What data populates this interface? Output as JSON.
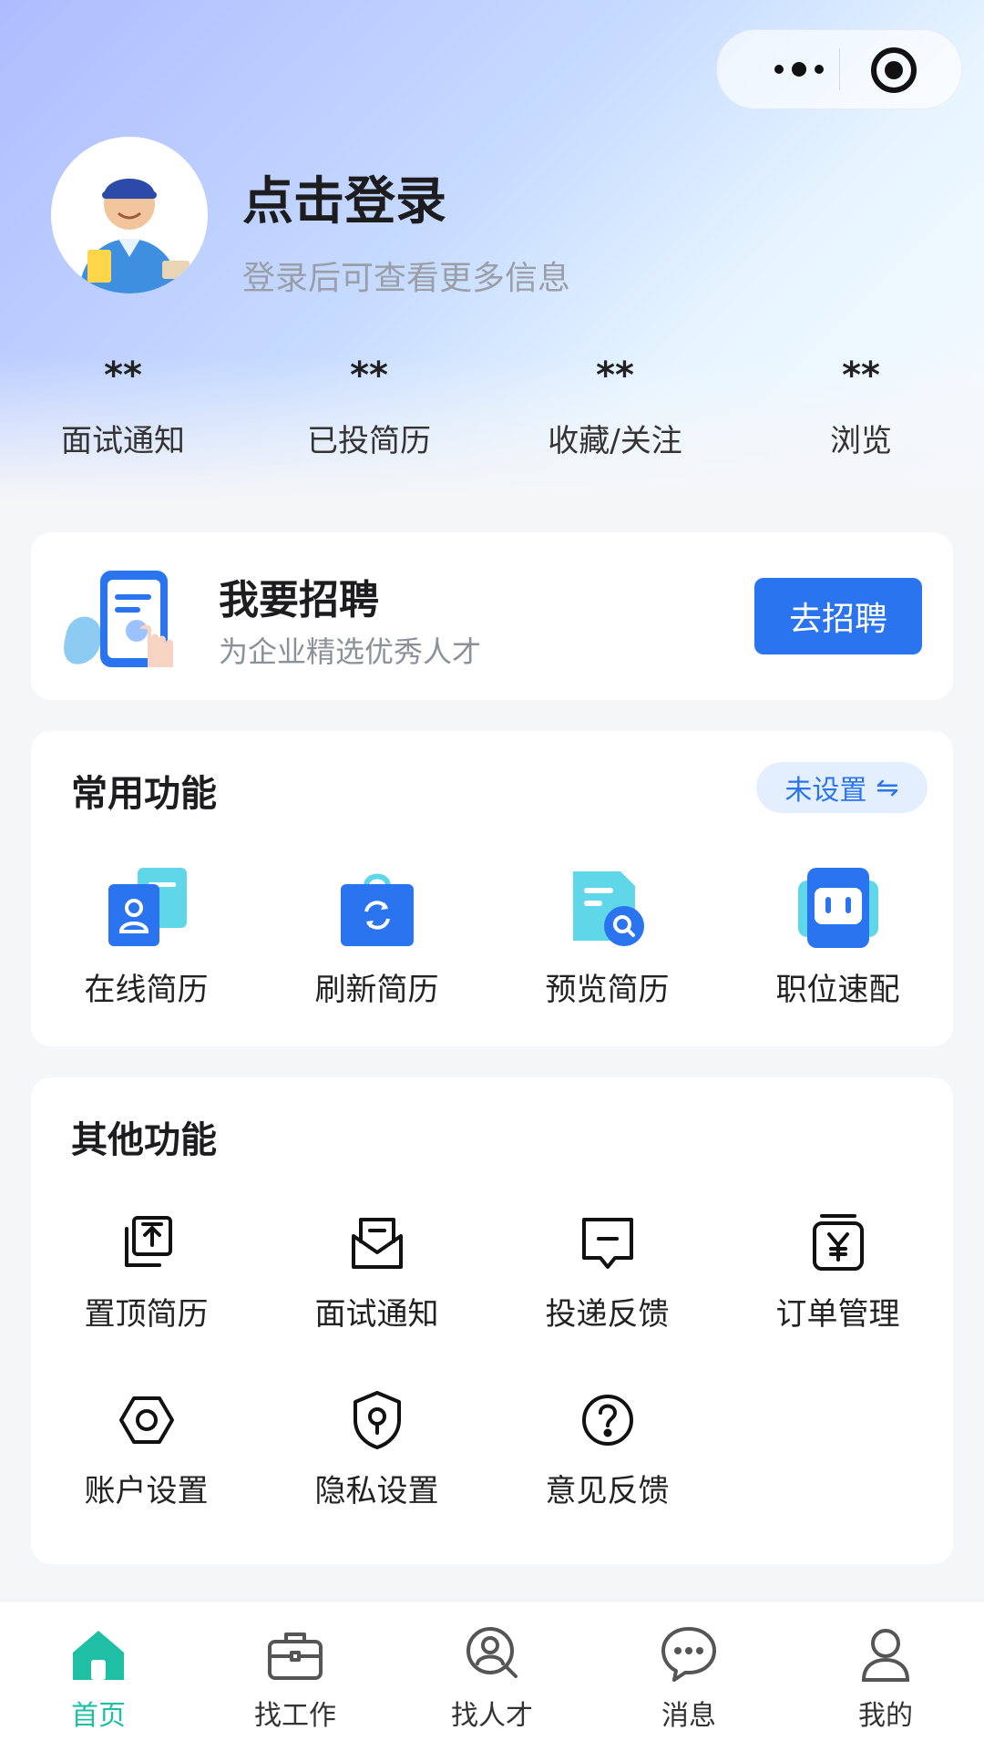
{
  "header": {
    "login_title": "点击登录",
    "login_subtitle": "登录后可查看更多信息"
  },
  "stats": [
    {
      "value": "**",
      "label": "面试通知"
    },
    {
      "value": "**",
      "label": "已投简历"
    },
    {
      "value": "**",
      "label": "收藏/关注"
    },
    {
      "value": "**",
      "label": "浏览"
    }
  ],
  "recruit": {
    "title": "我要招聘",
    "subtitle": "为企业精选优秀人才",
    "button": "去招聘"
  },
  "common": {
    "title": "常用功能",
    "setting_label": "未设置",
    "setting_glyph": "⇋",
    "items": [
      {
        "label": "在线简历",
        "icon": "resume-icon"
      },
      {
        "label": "刷新简历",
        "icon": "refresh-bag-icon"
      },
      {
        "label": "预览简历",
        "icon": "preview-icon"
      },
      {
        "label": "职位速配",
        "icon": "match-robot-icon"
      }
    ]
  },
  "other": {
    "title": "其他功能",
    "items": [
      {
        "label": "置顶简历",
        "icon": "pin-top-icon"
      },
      {
        "label": "面试通知",
        "icon": "mail-icon"
      },
      {
        "label": "投递反馈",
        "icon": "feedback-message-icon"
      },
      {
        "label": "订单管理",
        "icon": "yen-order-icon"
      },
      {
        "label": "账户设置",
        "icon": "hexagon-settings-icon"
      },
      {
        "label": "隐私设置",
        "icon": "shield-lock-icon"
      },
      {
        "label": "意见反馈",
        "icon": "question-icon"
      }
    ]
  },
  "tabbar": [
    {
      "label": "首页",
      "icon": "home-icon",
      "active": true
    },
    {
      "label": "找工作",
      "icon": "briefcase-icon",
      "active": false
    },
    {
      "label": "找人才",
      "icon": "search-person-icon",
      "active": false
    },
    {
      "label": "消息",
      "icon": "chat-icon",
      "active": false
    },
    {
      "label": "我的",
      "icon": "user-icon",
      "active": false
    }
  ],
  "colors": {
    "primary": "#2b74f0",
    "tab_active": "#1fbfa6",
    "pill_bg": "#e3efff"
  }
}
